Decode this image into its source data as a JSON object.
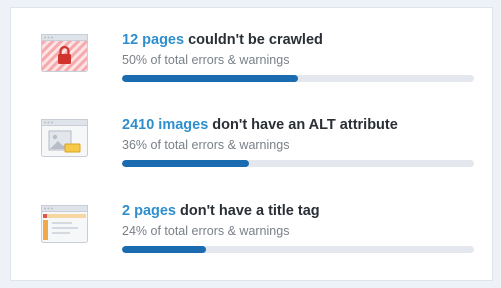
{
  "issues": [
    {
      "count": "12 pages",
      "text": " couldn't be crawled",
      "share": "50% of total errors & warnings",
      "fraction": 0.5,
      "icon": "locked-page-icon"
    },
    {
      "count": "2410 images",
      "text": " don't have an ALT attribute",
      "share": "36% of total errors & warnings",
      "fraction": 0.36,
      "icon": "image-missing-alt-icon"
    },
    {
      "count": "2 pages",
      "text": " don't have a title tag",
      "share": "24% of total errors & warnings",
      "fraction": 0.24,
      "icon": "page-missing-title-icon"
    }
  ],
  "colors": {
    "count": "#2f8fce",
    "bar_fill": "#1b6bb0",
    "bar_track": "#e4e8ee"
  }
}
